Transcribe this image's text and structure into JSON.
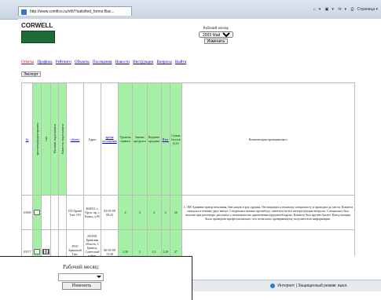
{
  "browser": {
    "tab_title": "http://www.comfico.ru/vth/?satisfied_forms:Bac...",
    "tools": [
      "▾",
      "▾",
      "▾",
      "Страница ▾"
    ]
  },
  "logo": {
    "text": "CORWELL"
  },
  "month": {
    "label": "Рабочий месяц:",
    "selected": "2009 Май",
    "button": "Изменить"
  },
  "nav": [
    "Отчеты",
    "Профиль",
    "Рейтинги",
    "Объекты",
    "Посещения",
    "Новости",
    "Инструкции",
    "Вопросы",
    "Выйти"
  ],
  "export_button": "Экспорт",
  "table": {
    "headers": {
      "num": "№",
      "view": "просмотр/редактировать",
      "c1": "тип",
      "c2": "Наличие видеозаписи",
      "c3": "Качество видеозаписи",
      "object": "объект",
      "address": "Адрес",
      "visit_time": "время посещения",
      "h1": "Уровень сервиса",
      "h2": "Знание продукта",
      "h3": "Ведение продажи",
      "h4": "Итог",
      "h5": "Сумма баллов (5,6)",
      "comment": "Комментарии проверяющего"
    },
    "rows": [
      {
        "num": "10569",
        "object": "ОО Оренб Тип: ОО",
        "address": "462021, г. Орск, пр. г. Камы, д.95",
        "time": "03-05-09 09:23",
        "s1": "4",
        "s2": "4",
        "s3": "4",
        "s4": "4",
        "s5": "26",
        "comment": "1. ЭМ Администратор вежливая, бан какую в рук оружия. Он направил к нужному специалисту и проводил до места. Клиента ожидала в течение двух минут. Специалист вызвал преамбулу, ответила на все интересующие вопросы. Специалист был вежлив при разговоре, рассказал о возможностях применения кредитной карты. Клиенту был вручен буклет. Консультация была проведена профессионально, что позволило проверяющему получить всю информацию."
      },
      {
        "num": "10577",
        "object": "РОО Брянский Тип: Клиент",
        "address": "241050, Брянская область, г. Брянск, Советский район, проспект Ленина, д. 36",
        "time": "06-05-09 15:30",
        "s1": "3,38",
        "s2": "3",
        "s3": "3,3",
        "s4": "3,29",
        "s5": "47",
        "comment": ""
      }
    ]
  },
  "status": {
    "text": "Интернет | Защищенный режим: выкл."
  },
  "zoom": {
    "label": "Рабочий месяц:",
    "button": "Изменить"
  }
}
